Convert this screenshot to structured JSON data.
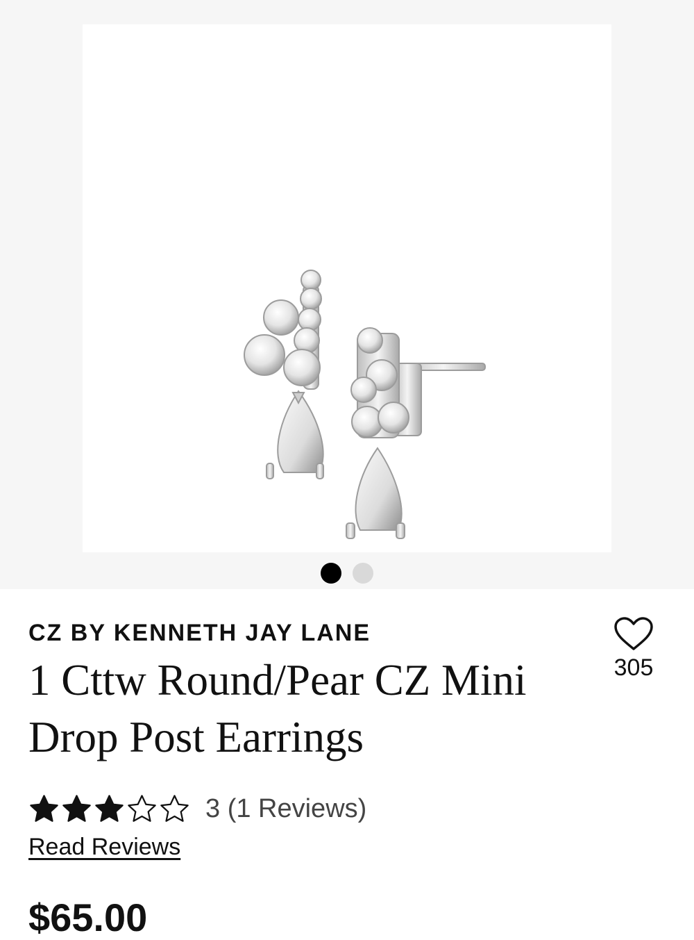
{
  "product": {
    "brand": "CZ BY KENNETH JAY LANE",
    "title": "1 Cttw Round/Pear CZ Mini Drop Post Earrings",
    "favorite_count": "305",
    "rating_value": 3,
    "rating_max": 5,
    "rating_text": "3 (1 Reviews)",
    "read_reviews_label": "Read Reviews",
    "price": "$65.00"
  },
  "gallery": {
    "image_count": 2,
    "active_index": 0
  }
}
